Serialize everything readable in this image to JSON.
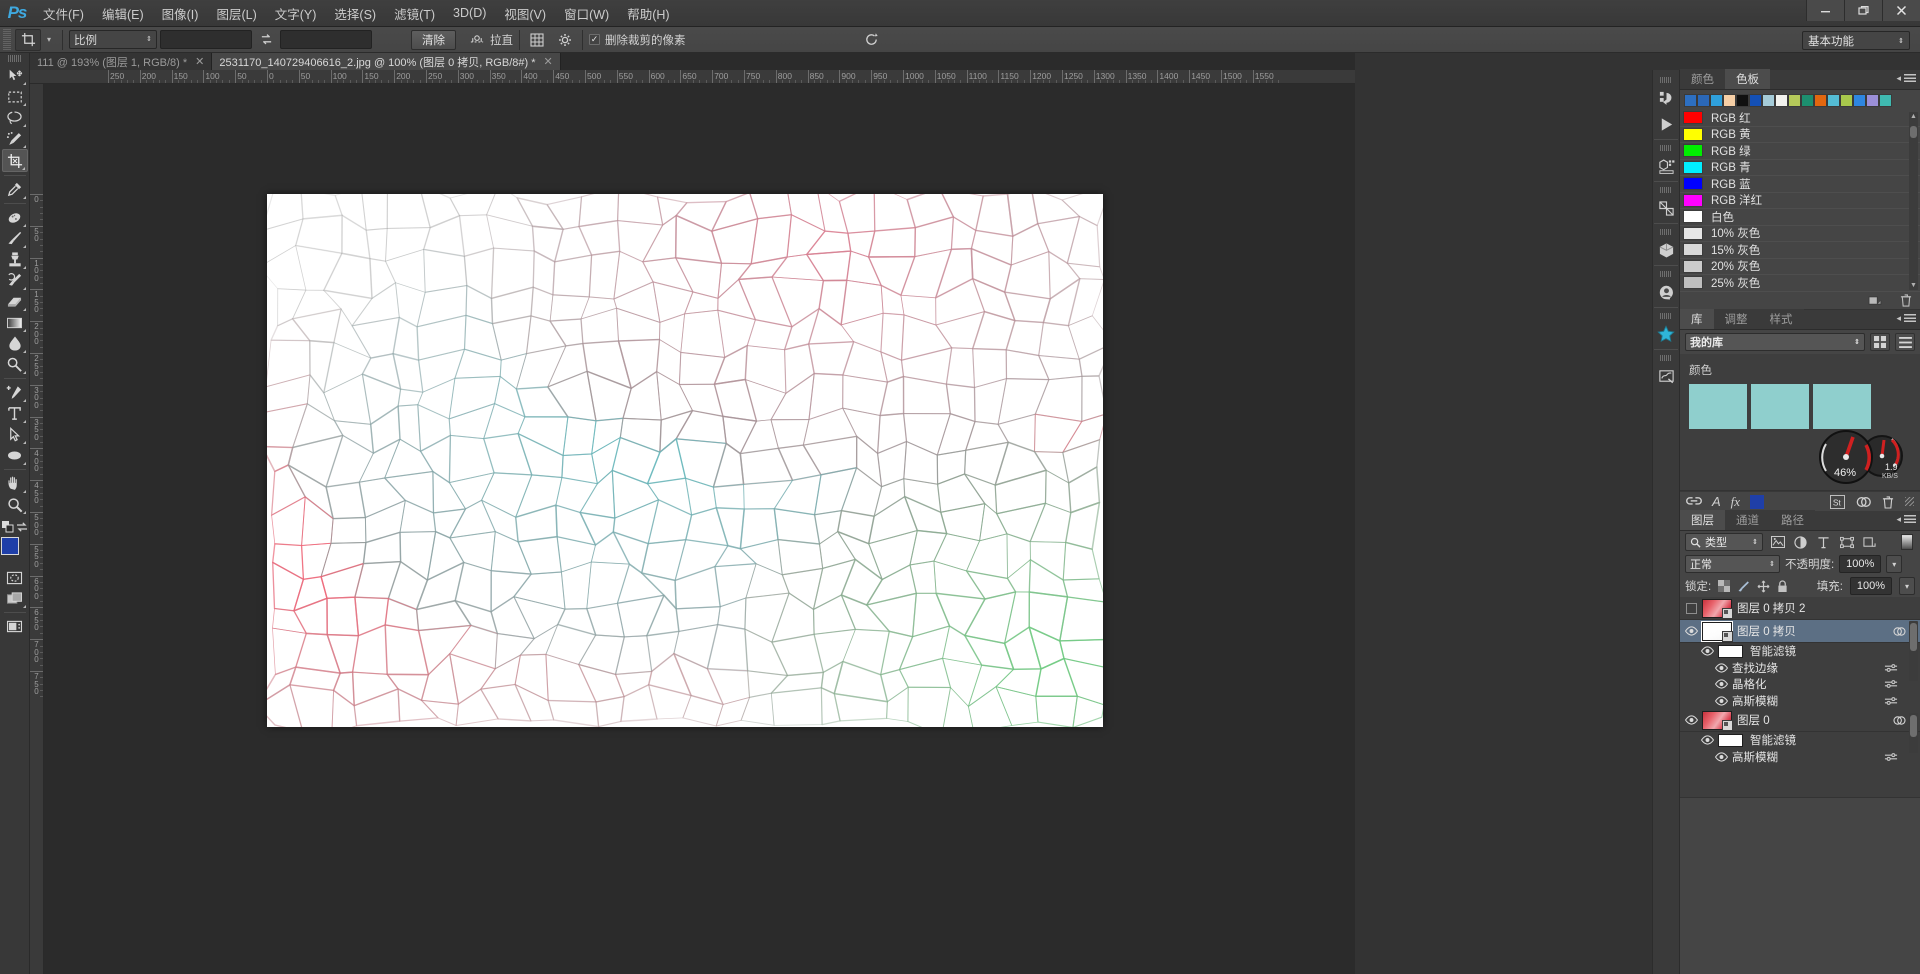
{
  "app": {
    "name": "Photoshop",
    "logo": "Ps"
  },
  "window_controls": {
    "minimize": "—",
    "restore": "❐",
    "close": "✕"
  },
  "menu": {
    "items": [
      {
        "label": "文件(F)",
        "name": "menu-file"
      },
      {
        "label": "编辑(E)",
        "name": "menu-edit"
      },
      {
        "label": "图像(I)",
        "name": "menu-image"
      },
      {
        "label": "图层(L)",
        "name": "menu-layer"
      },
      {
        "label": "文字(Y)",
        "name": "menu-type"
      },
      {
        "label": "选择(S)",
        "name": "menu-select"
      },
      {
        "label": "滤镜(T)",
        "name": "menu-filter"
      },
      {
        "label": "3D(D)",
        "name": "menu-3d"
      },
      {
        "label": "视图(V)",
        "name": "menu-view"
      },
      {
        "label": "窗口(W)",
        "name": "menu-window"
      },
      {
        "label": "帮助(H)",
        "name": "menu-help"
      }
    ]
  },
  "options_bar": {
    "tool_icon": "crop-tool-icon",
    "ratio_select": "比例",
    "width_value": "",
    "height_value": "",
    "swap_icon": "swap-arrows-icon",
    "clear_button": "清除",
    "straighten_label": "拉直",
    "straighten_icon": "straighten-icon",
    "overlay_icon": "grid-overlay-icon",
    "settings_icon": "gear-icon",
    "delete_cropped_label": "删除裁剪的像素",
    "delete_cropped_checked": true,
    "reset_icon": "reset-circle-icon",
    "workspace": "基本功能"
  },
  "tabs": [
    {
      "label": "111 @ 193% (图层 1, RGB/8) *",
      "active": false,
      "close": "✕"
    },
    {
      "label": "2531170_140729406616_2.jpg @ 100% (图层 0 拷贝, RGB/8#) *",
      "active": true,
      "close": "✕"
    }
  ],
  "toolbar": {
    "tools": [
      {
        "name": "move-tool",
        "icon": "move-icon",
        "selected": false
      },
      {
        "name": "marquee-tool",
        "icon": "rectangular-marquee-icon",
        "selected": false
      },
      {
        "name": "lasso-tool",
        "icon": "lasso-icon",
        "selected": false
      },
      {
        "name": "quick-selection-tool",
        "icon": "quick-selection-icon",
        "selected": false
      },
      {
        "name": "crop-tool",
        "icon": "crop-icon",
        "selected": true
      },
      {
        "name": "eyedropper-tool",
        "icon": "eyedropper-icon",
        "selected": false
      },
      {
        "name": "healing-brush-tool",
        "icon": "spot-healing-icon",
        "selected": false
      },
      {
        "name": "brush-tool",
        "icon": "brush-icon",
        "selected": false
      },
      {
        "name": "clone-stamp-tool",
        "icon": "clone-stamp-icon",
        "selected": false
      },
      {
        "name": "history-brush-tool",
        "icon": "history-brush-icon",
        "selected": false
      },
      {
        "name": "eraser-tool",
        "icon": "eraser-icon",
        "selected": false
      },
      {
        "name": "gradient-tool",
        "icon": "gradient-icon",
        "selected": false
      },
      {
        "name": "blur-tool",
        "icon": "blur-drop-icon",
        "selected": false
      },
      {
        "name": "dodge-tool",
        "icon": "dodge-icon",
        "selected": false
      },
      {
        "name": "pen-tool",
        "icon": "pen-icon",
        "selected": false
      },
      {
        "name": "type-tool",
        "icon": "type-t-icon",
        "selected": false
      },
      {
        "name": "path-selection-tool",
        "icon": "path-arrow-icon",
        "selected": false
      },
      {
        "name": "ellipse-shape-tool",
        "icon": "ellipse-icon",
        "selected": false
      },
      {
        "name": "hand-tool",
        "icon": "hand-icon",
        "selected": false
      },
      {
        "name": "zoom-tool",
        "icon": "magnifier-icon",
        "selected": false
      }
    ],
    "default_colors_icon": "default-colors-icon",
    "swap_colors_icon": "swap-colors-icon",
    "foreground_color": "#1f3fa8",
    "background_color": "#000000",
    "quickmask_icon": "quick-mask-icon",
    "screenmode_icon": "screen-mode-icon",
    "extra_icon": "toolbar-extra-icon"
  },
  "rulers": {
    "unit": "px",
    "h_labels": [
      "250",
      "200",
      "150",
      "100",
      "50",
      "0",
      "50",
      "100",
      "150",
      "200",
      "250",
      "300",
      "350",
      "400",
      "450",
      "500",
      "550",
      "600",
      "650",
      "700",
      "750",
      "800",
      "850",
      "900",
      "950",
      "1000",
      "1050",
      "1100",
      "1150",
      "1200",
      "1250"
    ],
    "v_labels": [
      "0",
      "50",
      "100",
      "150",
      "200",
      "250",
      "300",
      "350",
      "400",
      "450",
      "500",
      "550",
      "600",
      "650",
      "700"
    ]
  },
  "document": {
    "zoom": "100%",
    "artboard_bg": "#ffffff",
    "description": "crystallize / find-edges filtered photo rendered as a pale cracked-glass cell pattern"
  },
  "right_dock_strip": {
    "icons": [
      {
        "name": "history-icon",
        "label": "历史记录"
      },
      {
        "name": "actions-play-icon",
        "label": "动作"
      },
      {
        "name": "properties-icon",
        "label": "属性"
      },
      {
        "name": "3d-scene-icon",
        "label": "3D 图层"
      },
      {
        "name": "3d-cube-icon",
        "label": "3D"
      },
      {
        "name": "user-profile-icon",
        "label": "配置文件"
      },
      {
        "name": "star-icon",
        "label": "收藏"
      },
      {
        "name": "notes-icon",
        "label": "注释"
      }
    ]
  },
  "color_panel": {
    "tabs": [
      {
        "label": "颜色",
        "active": false
      },
      {
        "label": "色板",
        "active": true
      }
    ],
    "quick_swatches": [
      "#2d6fc1",
      "#2b68b8",
      "#2fa0dc",
      "#f6cfa6",
      "#101010",
      "#1450b6",
      "#a5cbd8",
      "#f2f2ee",
      "#b5c95a",
      "#1d8f6f",
      "#e2670f",
      "#54bcd4",
      "#a8c84c",
      "#2e86e0",
      "#9b8fd8",
      "#3fb9b0"
    ],
    "swatches": [
      {
        "name": "RGB 红",
        "color": "#ff0000"
      },
      {
        "name": "RGB 黄",
        "color": "#ffff00"
      },
      {
        "name": "RGB 绿",
        "color": "#00ee00"
      },
      {
        "name": "RGB 青",
        "color": "#00eeff"
      },
      {
        "name": "RGB 蓝",
        "color": "#0000ff"
      },
      {
        "name": "RGB 洋红",
        "color": "#ff00ff"
      },
      {
        "name": "白色",
        "color": "#ffffff"
      },
      {
        "name": "10% 灰色",
        "color": "#e6e6e6"
      },
      {
        "name": "15% 灰色",
        "color": "#d9d9d9"
      },
      {
        "name": "20% 灰色",
        "color": "#cccccc"
      },
      {
        "name": "25% 灰色",
        "color": "#bfbfbf"
      }
    ],
    "footer": {
      "new_swatch_icon": "new-swatch-icon",
      "delete_icon": "trash-icon"
    }
  },
  "library_panel": {
    "tabs": [
      {
        "label": "库",
        "active": true
      },
      {
        "label": "调整",
        "active": false
      },
      {
        "label": "样式",
        "active": false
      }
    ],
    "library_select": "我的库",
    "view_grid_icon": "grid-view-icon",
    "view_list_icon": "list-view-icon",
    "section_title": "颜色",
    "colors": [
      "#8fcfcd",
      "#8fcfcd",
      "#8fcfcd"
    ],
    "gauge": {
      "percent": "46%",
      "speed": "1.9",
      "speed_unit": "KB/S"
    }
  },
  "layers_panel": {
    "fx_bar": {
      "link_icon": "link-layers-icon",
      "fx_icon": "fx-icon",
      "mask_icon": "add-mask-icon",
      "adjustment_color": "#1f3fa8",
      "st_icon": "st-icon",
      "group_icon": "new-group-icon",
      "trash_icon": "trash-icon"
    },
    "tabs": [
      {
        "label": "图层",
        "active": true
      },
      {
        "label": "通道",
        "active": false
      },
      {
        "label": "路径",
        "active": false
      }
    ],
    "filter": {
      "search_icon": "search-icon",
      "kind_label": "类型",
      "icons": [
        "pixel-filter-icon",
        "adjustment-filter-icon",
        "type-filter-icon",
        "shape-filter-icon",
        "smartobject-filter-icon"
      ],
      "toggle_icon": "filter-toggle-icon"
    },
    "blend_mode": "正常",
    "opacity_label": "不透明度:",
    "opacity_value": "100%",
    "lock_label": "锁定:",
    "lock_icons": [
      "lock-transparent-icon",
      "lock-image-icon",
      "lock-position-icon",
      "lock-all-icon"
    ],
    "fill_label": "填充:",
    "fill_value": "100%",
    "layers": [
      {
        "name": "图层 0 拷贝 2",
        "visible": false,
        "selected": false,
        "thumb": "red-photo",
        "smart_object": true,
        "children": []
      },
      {
        "name": "图层 0 拷贝",
        "visible": true,
        "selected": true,
        "thumb": "white-crackle",
        "smart_object": true,
        "fx_icon": "smart-filter-icon",
        "children": [
          {
            "name": "智能滤镜",
            "visible": true,
            "type": "mask"
          },
          {
            "name": "查找边缘",
            "visible": true,
            "type": "filter",
            "blend_icon": "filter-options-icon"
          },
          {
            "name": "晶格化",
            "visible": true,
            "type": "filter",
            "blend_icon": "filter-options-icon"
          },
          {
            "name": "高斯模糊",
            "visible": true,
            "type": "filter",
            "blend_icon": "filter-options-icon"
          }
        ]
      },
      {
        "name": "图层 0",
        "visible": true,
        "selected": false,
        "thumb": "red-photo",
        "smart_object": true,
        "fx_icon": "smart-filter-icon",
        "children": [
          {
            "name": "智能滤镜",
            "visible": true,
            "type": "mask"
          },
          {
            "name": "高斯模糊",
            "visible": true,
            "type": "filter",
            "blend_icon": "filter-options-icon"
          }
        ]
      }
    ]
  }
}
